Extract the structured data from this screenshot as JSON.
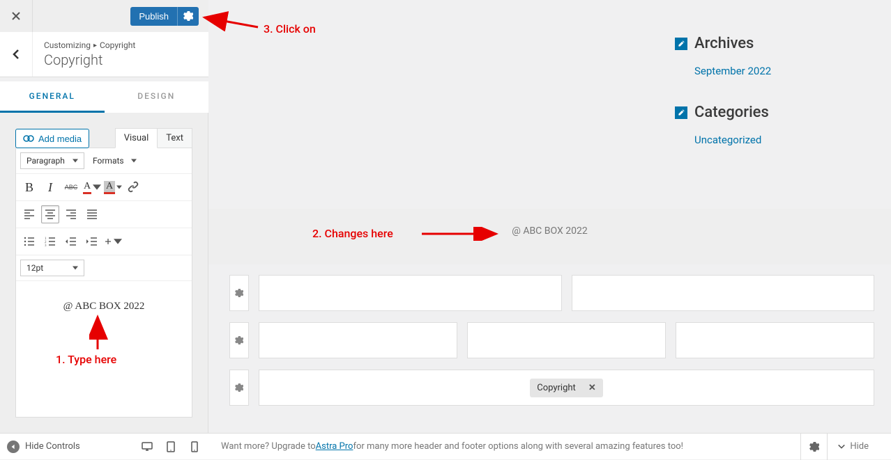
{
  "topbar": {
    "publish": "Publish"
  },
  "section": {
    "breadcrumb_root": "Customizing",
    "breadcrumb_leaf": "Copyright",
    "title": "Copyright"
  },
  "tabs": {
    "general": "GENERAL",
    "design": "DESIGN"
  },
  "editor": {
    "add_media": "Add media",
    "visual": "Visual",
    "text": "Text",
    "paragraph": "Paragraph",
    "formats": "Formats",
    "font_size": "12pt",
    "content": "@ ABC BOX 2022",
    "letter_a": "A",
    "abc": "ABC",
    "bold": "B",
    "italic": "I"
  },
  "widgets": {
    "archives_title": "Archives",
    "archives_link": "September 2022",
    "categories_title": "Categories",
    "categories_link": "Uncategorized"
  },
  "footer_preview": "@ ABC BOX 2022",
  "chip": "Copyright",
  "annotations": {
    "a1": "1. Type here",
    "a2": "2. Changes here",
    "a3": "3. Click on"
  },
  "bottom": {
    "hide_controls": "Hide Controls",
    "promo_pre": "Want more? Upgrade to ",
    "promo_link": "Astra Pro",
    "promo_post": " for many more header and footer options along with several amazing features too!",
    "hide": "Hide"
  }
}
